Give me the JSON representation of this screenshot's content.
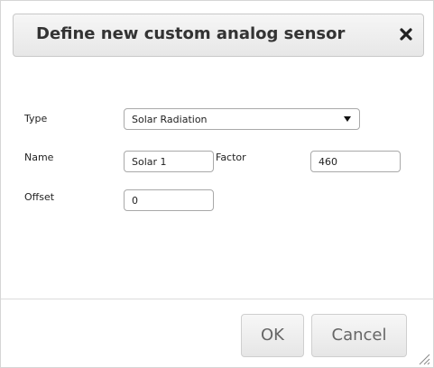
{
  "dialog": {
    "title": "Define new custom analog sensor",
    "close_icon": "close-x-icon"
  },
  "form": {
    "type_label": "Type",
    "type_value": "Solar Radiation",
    "name_label": "Name",
    "name_value": "Solar 1",
    "factor_label": "Factor",
    "factor_value": "460",
    "offset_label": "Offset",
    "offset_value": "0"
  },
  "buttons": {
    "ok_label": "OK",
    "cancel_label": "Cancel"
  },
  "colors": {
    "title_text": "#333333",
    "border": "#a9a9a9",
    "button_text": "#666666"
  }
}
